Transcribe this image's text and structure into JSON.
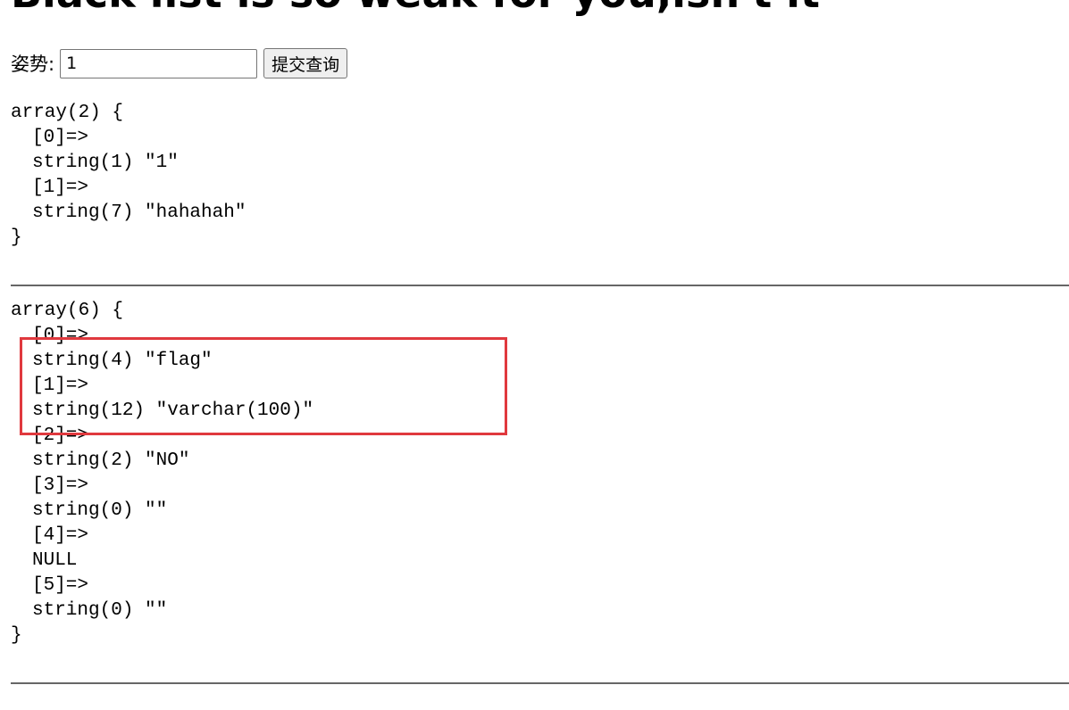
{
  "page": {
    "title": "Black list is so weak for you,isn't it"
  },
  "form": {
    "label": "姿势:",
    "input_value": "1",
    "submit_label": "提交查询"
  },
  "result1": {
    "header": "array(2) {",
    "items": [
      {
        "key": "[0]=>",
        "value": "string(1) \"1\""
      },
      {
        "key": "[1]=>",
        "value": "string(7) \"hahahah\""
      }
    ],
    "footer": "}"
  },
  "result2": {
    "header": "array(6) {",
    "items": [
      {
        "key": "[0]=>",
        "value": "string(4) \"flag\""
      },
      {
        "key": "[1]=>",
        "value": "string(12) \"varchar(100)\""
      },
      {
        "key": "[2]=>",
        "value": "string(2) \"NO\""
      },
      {
        "key": "[3]=>",
        "value": "string(0) \"\""
      },
      {
        "key": "[4]=>",
        "value": "NULL"
      },
      {
        "key": "[5]=>",
        "value": "string(0) \"\""
      }
    ],
    "footer": "}"
  },
  "annotation": {
    "color": "#e0393e",
    "highlighted_items": [
      "result2.items.0",
      "result2.items.1"
    ]
  }
}
